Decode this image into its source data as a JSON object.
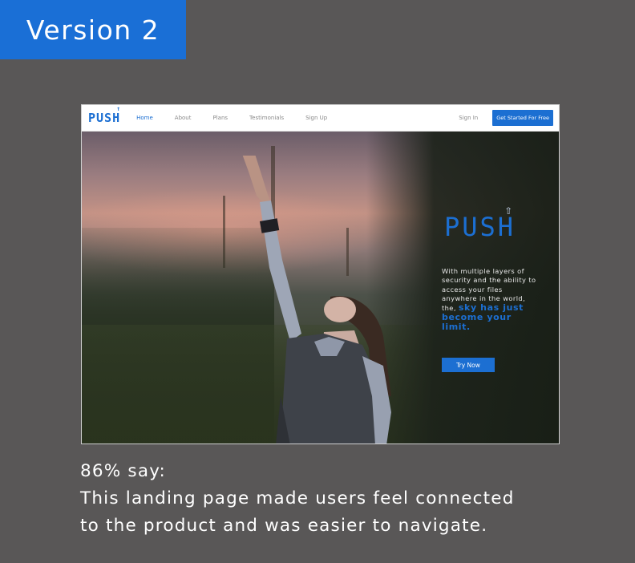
{
  "version_tag": "Version 2",
  "mockup": {
    "nav": {
      "logo": "PUSH",
      "links": [
        "Home",
        "About",
        "Plans",
        "Testimonials",
        "Sign Up"
      ],
      "active_link": "Home",
      "sign_in": "Sign In",
      "cta": "Get Started For Free"
    },
    "hero": {
      "logo": "PUSH",
      "body_line1": "With multiple layers of",
      "body_line2": "security and the ability to",
      "body_line3": "access your files",
      "body_line4": "anywhere in the world,",
      "body_line5_prefix": "the,",
      "highlight_line1": "sky has just",
      "highlight_line2": "become your",
      "highlight_line3": "limit.",
      "button": "Try Now"
    }
  },
  "caption": {
    "line1": "86% say:",
    "line2": "This landing page made users feel connected",
    "line3": "to the product and was easier to navigate."
  },
  "colors": {
    "background": "#595757",
    "accent": "#1a6fd6"
  }
}
